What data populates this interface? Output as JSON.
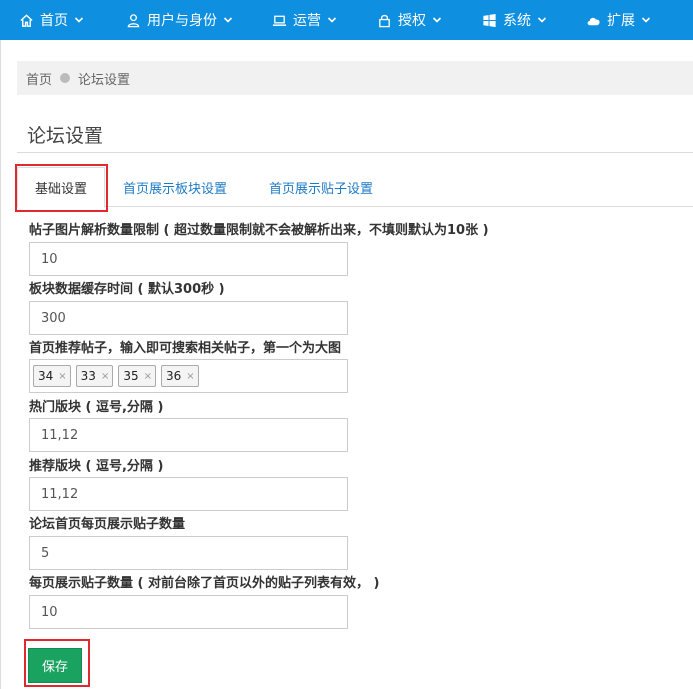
{
  "nav": {
    "items": [
      {
        "label": "首页",
        "icon": "home-icon"
      },
      {
        "label": "用户与身份",
        "icon": "user-icon"
      },
      {
        "label": "运营",
        "icon": "laptop-icon"
      },
      {
        "label": "授权",
        "icon": "lock-icon"
      },
      {
        "label": "系统",
        "icon": "windows-icon"
      },
      {
        "label": "扩展",
        "icon": "cloud-icon"
      }
    ]
  },
  "breadcrumb": {
    "home": "首页",
    "current": "论坛设置"
  },
  "page": {
    "title": "论坛设置"
  },
  "tabs": [
    {
      "label": "基础设置",
      "active": true
    },
    {
      "label": "首页展示板块设置",
      "active": false
    },
    {
      "label": "首页展示贴子设置",
      "active": false
    }
  ],
  "form": {
    "image_limit": {
      "label": "帖子图片解析数量限制 ( 超过数量限制就不会被解析出来，不填则默认为10张 )",
      "value": "10"
    },
    "cache_time": {
      "label": "板块数据缓存时间 ( 默认300秒 )",
      "value": "300"
    },
    "recommended_posts": {
      "label": "首页推荐帖子，输入即可搜索相关帖子，第一个为大图",
      "tags": [
        "34",
        "33",
        "35",
        "36"
      ]
    },
    "hot_boards": {
      "label": "热门版块 ( 逗号,分隔 )",
      "value": "11,12"
    },
    "recommended_boards": {
      "label": "推荐版块 ( 逗号,分隔 )",
      "value": "11,12"
    },
    "posts_per_page_home": {
      "label": "论坛首页每页展示贴子数量",
      "value": "5"
    },
    "posts_per_page": {
      "label": "每页展示贴子数量 ( 对前台除了首页以外的贴子列表有效， )",
      "value": "10"
    }
  },
  "actions": {
    "save_label": "保存"
  },
  "colors": {
    "nav_bg": "#0e8fe0",
    "save_bg": "#1aa261",
    "highlight": "#e0282e",
    "link": "#1e7ac5"
  }
}
